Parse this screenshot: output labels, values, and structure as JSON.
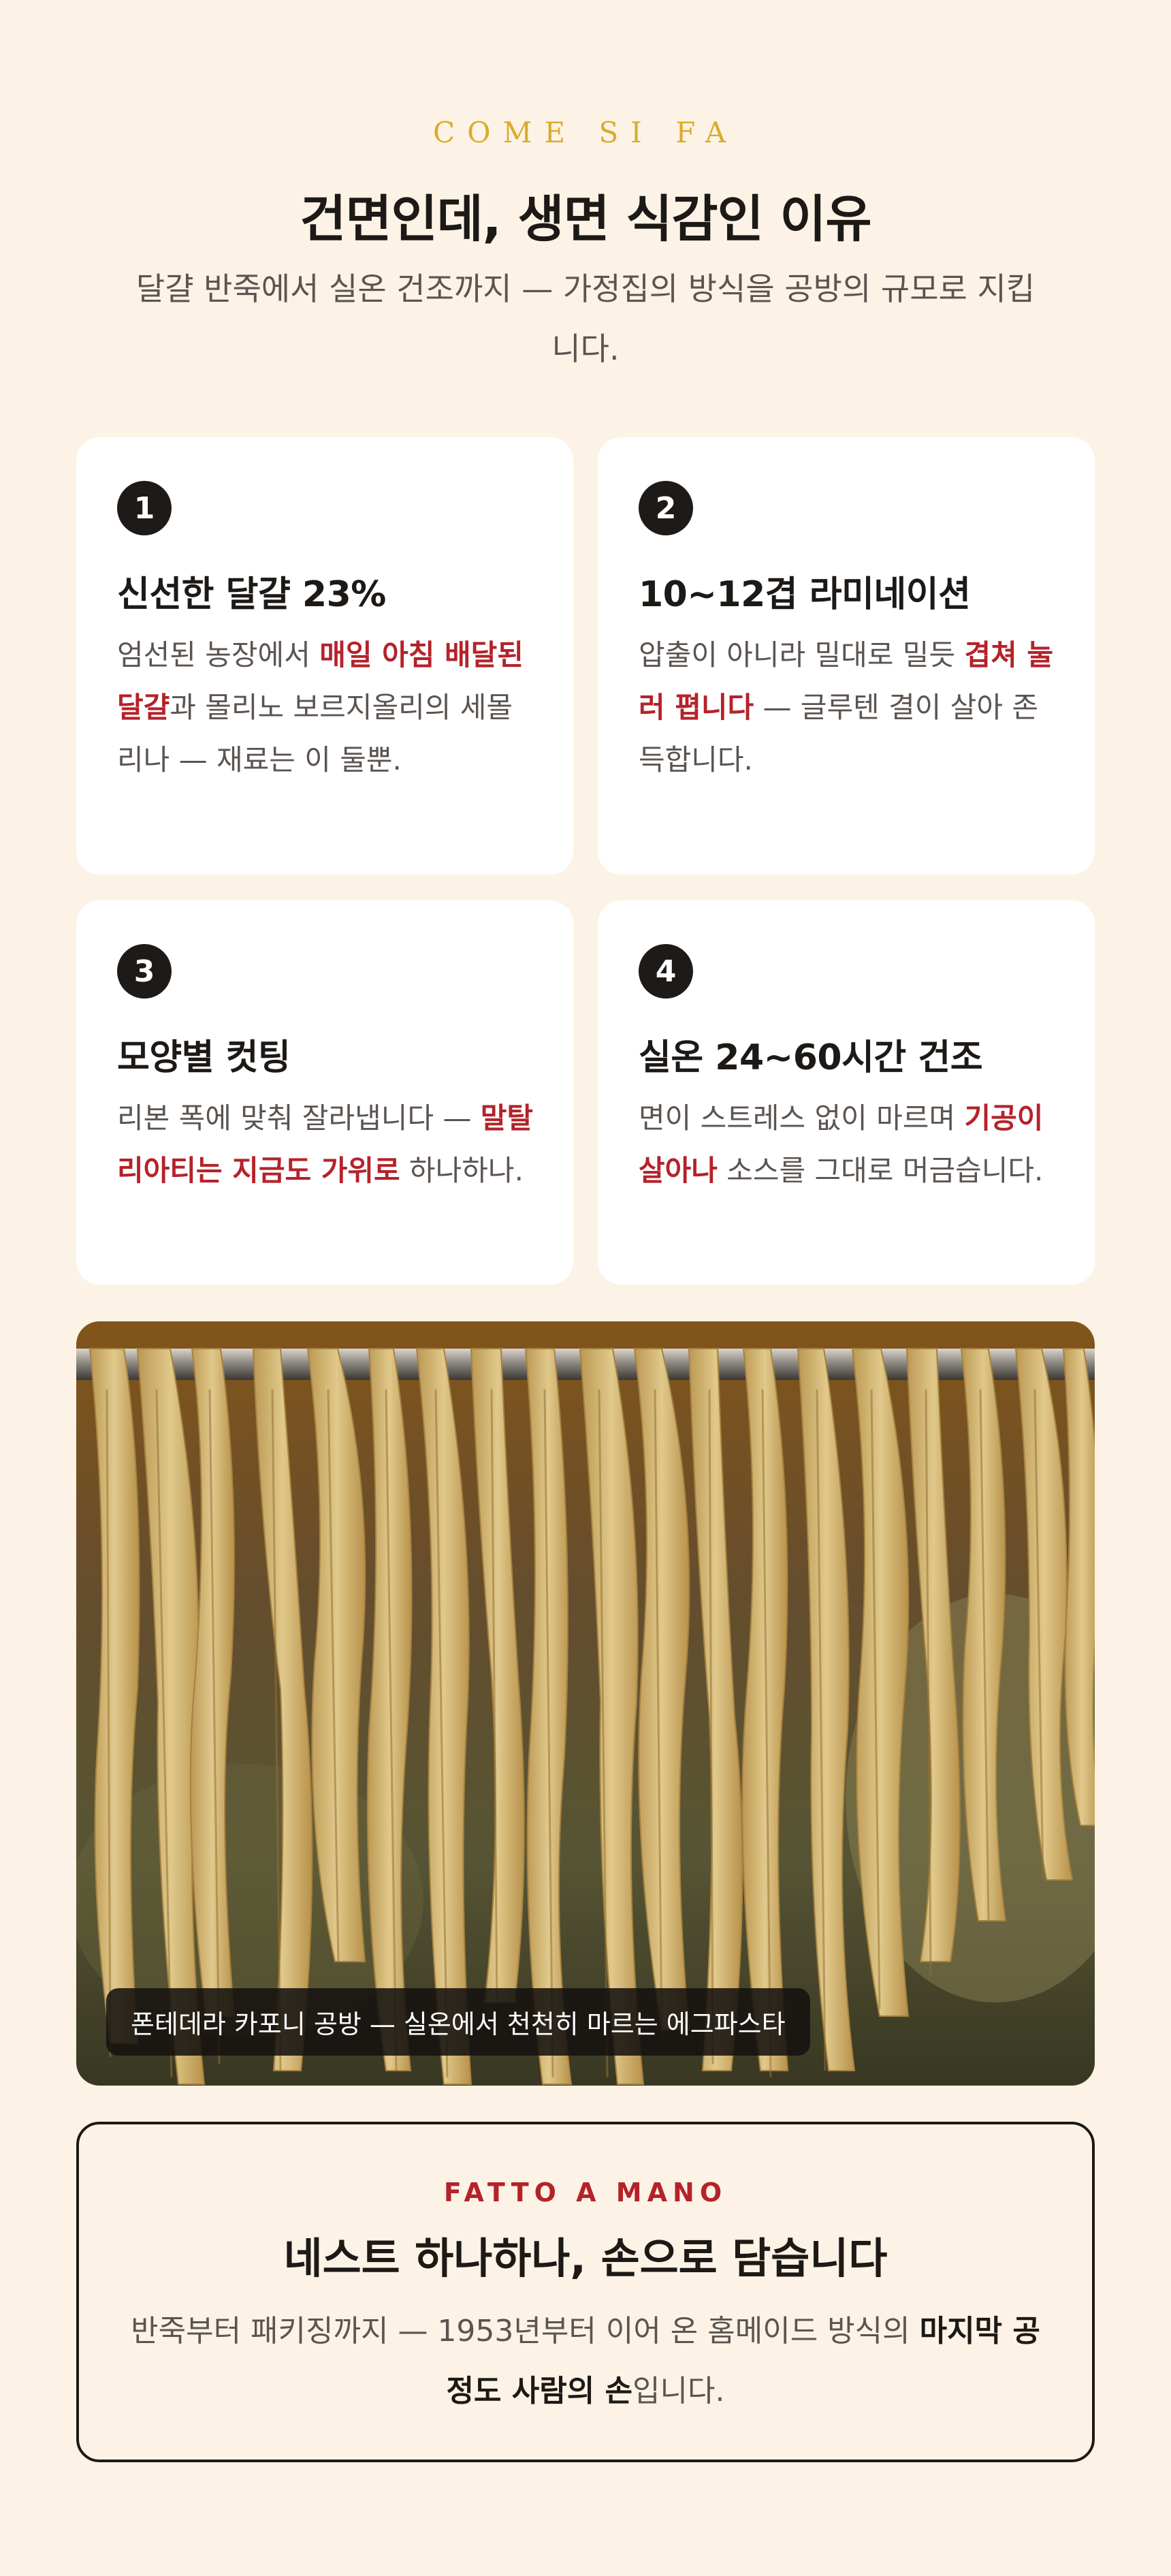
{
  "header": {
    "eyebrow": "COME SI FA",
    "title": "건면인데, 생면 식감인 이유",
    "subtitle": "달걀 반죽에서 실온 건조까지 — 가정집의 방식을 공방의 규모로 지킵니다."
  },
  "steps": [
    {
      "num": "1",
      "title": "신선한 달걀 23%",
      "body_pre": "엄선된 농장에서 ",
      "body_hl": "매일 아침 배달된 달걀",
      "body_post": "과 몰리노 보르지올리의 세몰리나 — 재료는 이 둘뿐."
    },
    {
      "num": "2",
      "title": "10~12겹 라미네이션",
      "body_pre": "압출이 아니라 밀대로 밀듯 ",
      "body_hl": "겹쳐 눌러 폅니다",
      "body_post": " — 글루텐 결이 살아 존득합니다."
    },
    {
      "num": "3",
      "title": "모양별 컷팅",
      "body_pre": "리본 폭에 맞춰 잘라냅니다 — ",
      "body_hl": "말탈리아티는 지금도 가위로",
      "body_post": " 하나하나."
    },
    {
      "num": "4",
      "title": "실온 24~60시간 건조",
      "body_pre": "면이 스트레스 없이 마르며 ",
      "body_hl": "기공이 살아나",
      "body_post": " 소스를 그대로 머금습니다."
    }
  ],
  "photo": {
    "caption": "폰테데라 카포니 공방 — 실온에서 천천히 마르는 에그파스타"
  },
  "closing": {
    "eyebrow": "FATTO A MANO",
    "title": "네스트 하나하나, 손으로 담습니다",
    "body_pre": "반죽부터 패키징까지 — 1953년부터 이어 온 홈메이드 방식의 ",
    "body_bold": "마지막 공정도 사람의 손",
    "body_post": "입니다."
  },
  "colors": {
    "background": "#fcf3e6",
    "accent_gold": "#d9ac2b",
    "accent_red": "#b5222a",
    "ink": "#1c1916"
  }
}
